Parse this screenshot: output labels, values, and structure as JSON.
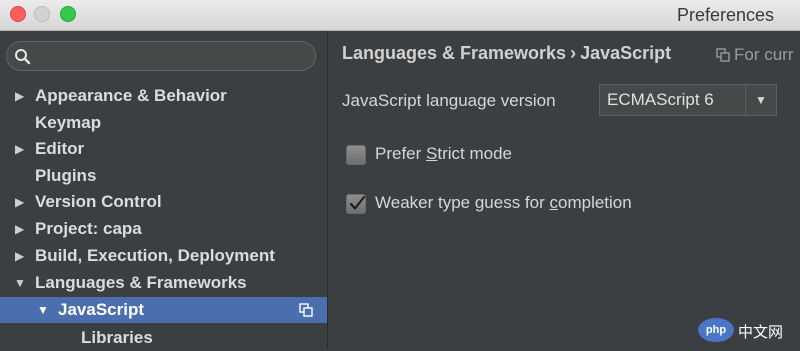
{
  "window": {
    "title": "Preferences"
  },
  "sidebar": {
    "search": {
      "placeholder": "",
      "value": ""
    },
    "items": [
      {
        "label": "Appearance & Behavior",
        "expandable": true,
        "expanded": false
      },
      {
        "label": "Keymap",
        "expandable": false
      },
      {
        "label": "Editor",
        "expandable": true,
        "expanded": false
      },
      {
        "label": "Plugins",
        "expandable": false
      },
      {
        "label": "Version Control",
        "expandable": true,
        "expanded": false
      },
      {
        "label": "Project: capa",
        "expandable": true,
        "expanded": false
      },
      {
        "label": "Build, Execution, Deployment",
        "expandable": true,
        "expanded": false
      },
      {
        "label": "Languages & Frameworks",
        "expandable": true,
        "expanded": true
      },
      {
        "label": "JavaScript",
        "expandable": true,
        "expanded": true,
        "selected": true
      },
      {
        "label": "Libraries",
        "expandable": false
      }
    ]
  },
  "main": {
    "breadcrumb": {
      "parent": "Languages & Frameworks",
      "separator": "›",
      "current": "JavaScript"
    },
    "scope_note": "For curr",
    "language_version": {
      "label": "JavaScript language version",
      "value": "ECMAScript 6"
    },
    "options": [
      {
        "label_pre": "Prefer ",
        "mnemonic": "S",
        "label_post": "trict mode",
        "checked": false
      },
      {
        "label_pre": "Weaker type guess for ",
        "mnemonic": "c",
        "label_post": "ompletion",
        "checked": true
      }
    ]
  },
  "watermark": {
    "badge": "php",
    "text": "中文网"
  },
  "colors": {
    "selection": "#4b6eaf",
    "background": "#3c3f41",
    "titlebar": "#dcdcdc"
  }
}
